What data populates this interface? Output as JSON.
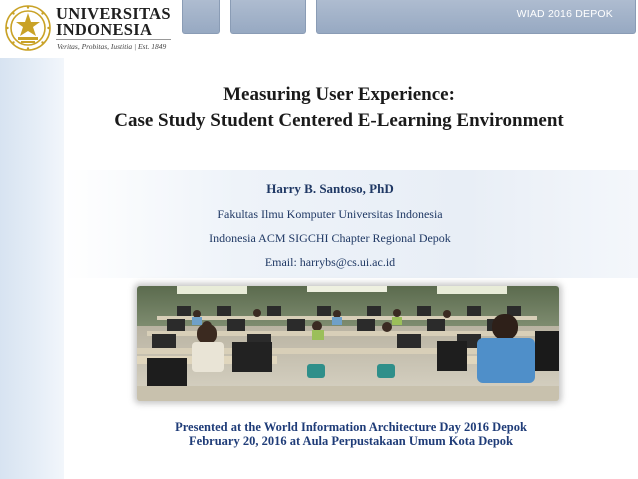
{
  "header": {
    "event_label": "WIAD 2016 DEPOK"
  },
  "logo": {
    "line1": "UNIVERSITAS",
    "line2": "INDONESIA",
    "motto": "Veritas, Probitas, Iustitia | Est. 1849",
    "seal_icon": "university-seal-icon"
  },
  "title": {
    "line1": "Measuring User Experience:",
    "line2": "Case Study Student Centered E-Learning Environment"
  },
  "author": {
    "name": "Harry B. Santoso, PhD",
    "affiliation": "Fakultas Ilmu Komputer Universitas Indonesia",
    "chapter": "Indonesia ACM SIGCHI Chapter Regional Depok",
    "email": "Email: harrybs@cs.ui.ac.id"
  },
  "footer": {
    "line1": "Presented at the World Information Architecture Day 2016 Depok",
    "line2": "February 20, 2016 at Aula Perpustakaan Umum Kota Depok"
  },
  "colors": {
    "accent_blue": "#1f3c78",
    "box_blue": "#9fb0c8",
    "seal_gold": "#c9a227"
  }
}
